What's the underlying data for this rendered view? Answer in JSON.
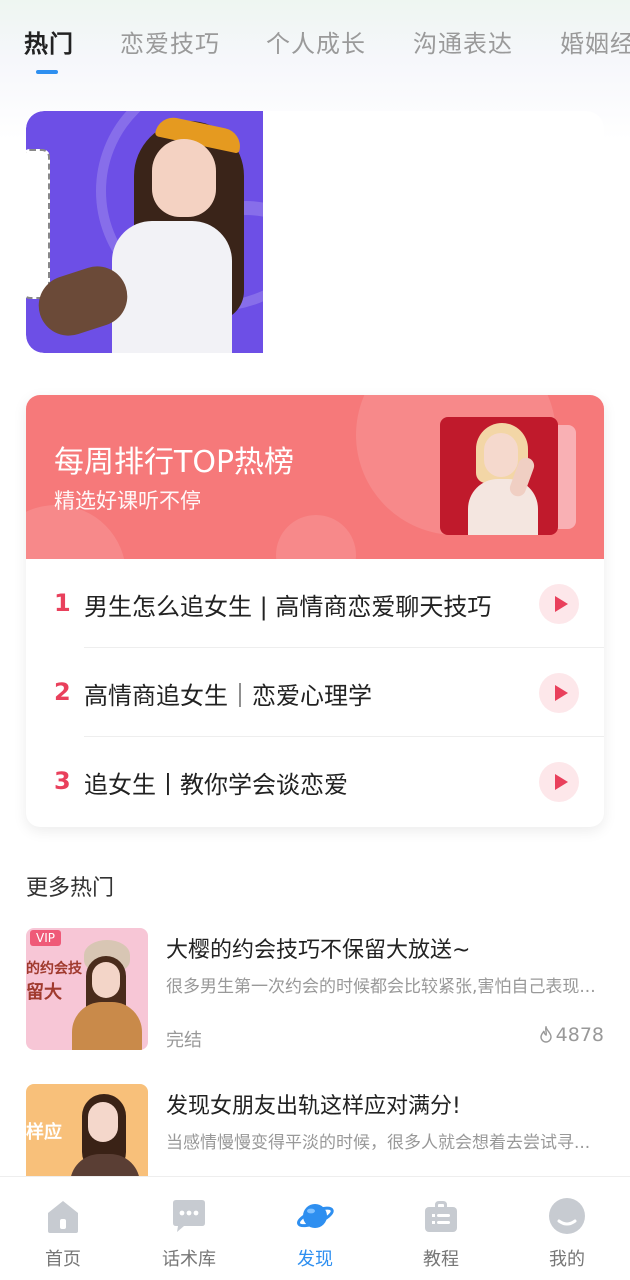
{
  "tabs": [
    {
      "label": "热门",
      "active": true
    },
    {
      "label": "恋爱技巧",
      "active": false
    },
    {
      "label": "个人成长",
      "active": false
    },
    {
      "label": "沟通表达",
      "active": false
    },
    {
      "label": "婚姻经",
      "active": false
    }
  ],
  "ranking": {
    "title": "每周排行TOP热榜",
    "subtitle": "精选好课听不停",
    "items": [
      {
        "rank": "1",
        "title": "男生怎么追女生 | 高情商恋爱聊天技巧"
      },
      {
        "rank": "2",
        "title": "高情商追女生｜恋爱心理学"
      },
      {
        "rank": "3",
        "title": "追女生丨教你学会谈恋爱"
      }
    ]
  },
  "more": {
    "title": "更多热门",
    "items": [
      {
        "badge": "VIP",
        "title": "大樱的约会技巧不保留大放送~",
        "desc": "很多男生第一次约会的时候都会比较紧张,害怕自己表现...",
        "status": "完结",
        "views": "4878"
      },
      {
        "title": "发现女朋友出轨这样应对满分!",
        "desc": "当感情慢慢变得平淡的时候，很多人就会想着去尝试寻..."
      }
    ]
  },
  "nav": [
    {
      "label": "首页",
      "icon": "home-icon"
    },
    {
      "label": "话术库",
      "icon": "chat-icon"
    },
    {
      "label": "发现",
      "icon": "planet-icon",
      "active": true
    },
    {
      "label": "教程",
      "icon": "briefcase-icon"
    },
    {
      "label": "我的",
      "icon": "profile-icon"
    }
  ],
  "colors": {
    "accent": "#2e8ff0",
    "rank_header": "#f6797a",
    "rank_number": "#e9405c",
    "banner_purple": "#6d4fe6"
  }
}
